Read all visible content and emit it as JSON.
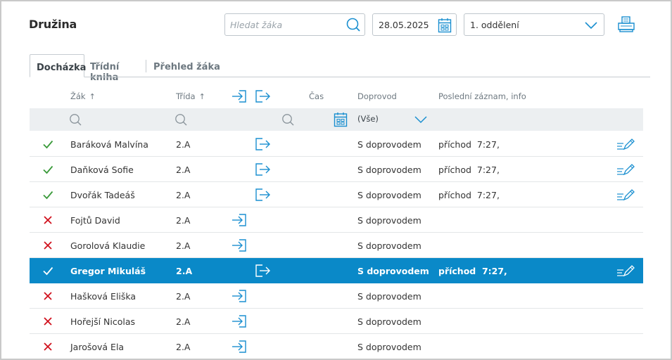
{
  "header": {
    "title": "Družina",
    "search_placeholder": "Hledat žáka",
    "search_value": "",
    "date": "28.05.2025",
    "department": "1. oddělení"
  },
  "tabs": [
    {
      "label": "Docházka",
      "active": true
    },
    {
      "label": "Třídní kniha",
      "active": false
    },
    {
      "label": "Přehled žáka",
      "active": false
    }
  ],
  "columns": {
    "student": "Žák",
    "sort_arrow": "↑",
    "class": "Třída",
    "time": "Čas",
    "escort": "Doprovod",
    "last_record": "Poslední záznam, info"
  },
  "filters": {
    "escort_value": "(Vše)"
  },
  "colors": {
    "accent": "#0a89c8",
    "icon_blue": "#1a8fd0",
    "present_green": "#3a9a3a",
    "absent_red": "#d0101c"
  },
  "rows": [
    {
      "status": "present",
      "name": "Baráková Malvína",
      "class": "2.A",
      "action": "departure",
      "escort": "S doprovodem",
      "record": "příchod  7:27,",
      "selected": false
    },
    {
      "status": "present",
      "name": "Daňková Sofie",
      "class": "2.A",
      "action": "departure",
      "escort": "S doprovodem",
      "record": "příchod  7:27,",
      "selected": false
    },
    {
      "status": "present",
      "name": "Dvořák Tadeáš",
      "class": "2.A",
      "action": "departure",
      "escort": "S doprovodem",
      "record": "příchod  7:27,",
      "selected": false
    },
    {
      "status": "absent",
      "name": "Fojtů David",
      "class": "2.A",
      "action": "arrival",
      "escort": "S doprovodem",
      "record": "",
      "selected": false
    },
    {
      "status": "absent",
      "name": "Gorolová Klaudie",
      "class": "2.A",
      "action": "arrival",
      "escort": "S doprovodem",
      "record": "",
      "selected": false
    },
    {
      "status": "present",
      "name": "Gregor Mikuláš",
      "class": "2.A",
      "action": "departure",
      "escort": "S doprovodem",
      "record": "příchod  7:27,",
      "selected": true
    },
    {
      "status": "absent",
      "name": "Hašková Eliška",
      "class": "2.A",
      "action": "arrival",
      "escort": "S doprovodem",
      "record": "",
      "selected": false
    },
    {
      "status": "absent",
      "name": "Hořejší Nicolas",
      "class": "2.A",
      "action": "arrival",
      "escort": "S doprovodem",
      "record": "",
      "selected": false
    },
    {
      "status": "absent",
      "name": "Jarošová Ela",
      "class": "2.A",
      "action": "arrival",
      "escort": "S doprovodem",
      "record": "",
      "selected": false
    }
  ]
}
